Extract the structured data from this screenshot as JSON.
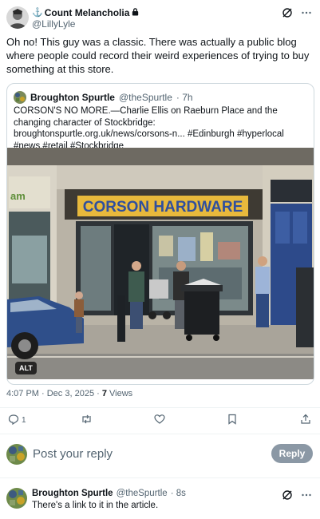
{
  "post": {
    "author_name": "Count Melancholia",
    "author_handle": "@LillyLyle",
    "text": "Oh no! This guy was a classic. There was actually a public blog where people could record their weird experiences of trying to buy something at this store.",
    "timestamp": "4:07 PM · Dec 3, 2025 · ",
    "views_count": "7",
    "views_label": " Views"
  },
  "quote": {
    "author_name": "Broughton Spurtle",
    "author_handle": "@theSpurtle",
    "time": "· 7h",
    "text": "CORSON'S NO MORE.—Charlie Ellis on Raeburn Place and the changing character of Stockbridge:  broughtonspurtle.org.uk/news/corsons-n... #Edinburgh #hyperlocal #news  #retail #Stockbridge",
    "image_sign": "CORSON HARDWARE",
    "alt_badge": "ALT"
  },
  "actions": {
    "reply_count": "1"
  },
  "reply_box": {
    "placeholder": "Post your reply",
    "button_label": "Reply"
  },
  "reply_post": {
    "author_name": "Broughton Spurtle",
    "author_handle": "@theSpurtle",
    "time": "· 8s",
    "text": "There's a link to it in the article."
  },
  "colors": {
    "text": "#0f1419",
    "secondary": "#536471",
    "border": "#cfd9de",
    "reply_button": "#8b98a5"
  }
}
